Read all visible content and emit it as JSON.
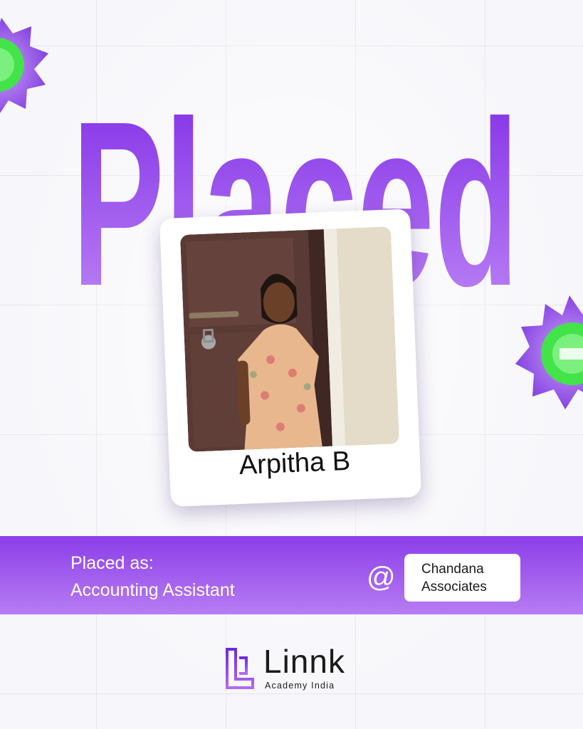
{
  "poster": {
    "headline": "Placed",
    "student_name": "Arpitha B",
    "role_label": "Placed as:",
    "role_value": "Accounting Assistant",
    "at_symbol": "@",
    "company_line1": "Chandana",
    "company_line2": "Associates"
  },
  "brand": {
    "name": "Linnk",
    "subtitle": "Academy India"
  },
  "colors": {
    "accent_purple": "#8b3ee8",
    "light_purple": "#b77cf3",
    "badge_green": "#43e34a",
    "text_dark": "#111111"
  },
  "icons": [
    "left-badge-icon",
    "right-badge-icon",
    "linnk-logo-icon"
  ]
}
